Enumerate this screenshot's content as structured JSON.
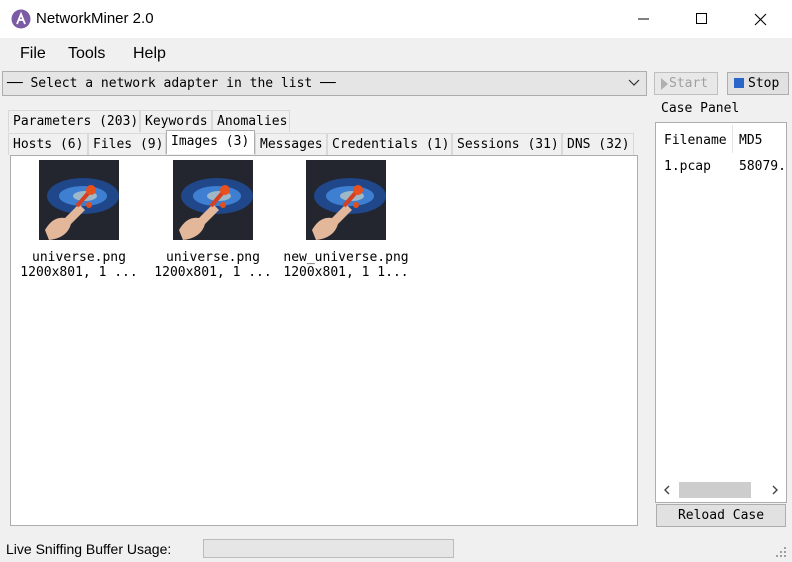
{
  "window": {
    "title": "NetworkMiner 2.0"
  },
  "menu": [
    "File",
    "Tools",
    "Help"
  ],
  "adapter": {
    "text": "── Select a network adapter in the list ──"
  },
  "buttons": {
    "start": "Start",
    "stop": "Stop",
    "reload": "Reload Case"
  },
  "tabs_row1": [
    "Parameters (203)",
    "Keywords",
    "Anomalies"
  ],
  "tabs_row2": [
    "Hosts (6)",
    "Files (9)",
    "Images (3)",
    "Messages",
    "Credentials (1)",
    "Sessions (31)",
    "DNS (32)"
  ],
  "active_tab": "Images (3)",
  "images": [
    {
      "name": "universe.png",
      "info": "1200x801, 1 ..."
    },
    {
      "name": "universe.png",
      "info": "1200x801, 1 ..."
    },
    {
      "name": "new_universe.png",
      "info": "1200x801, 1 1..."
    }
  ],
  "case_panel": {
    "title": "Case Panel",
    "columns": [
      "Filename",
      "MD5"
    ],
    "rows": [
      [
        "1.pcap",
        "58079."
      ]
    ]
  },
  "status": {
    "buffer_label": "Live Sniffing Buffer Usage:"
  }
}
